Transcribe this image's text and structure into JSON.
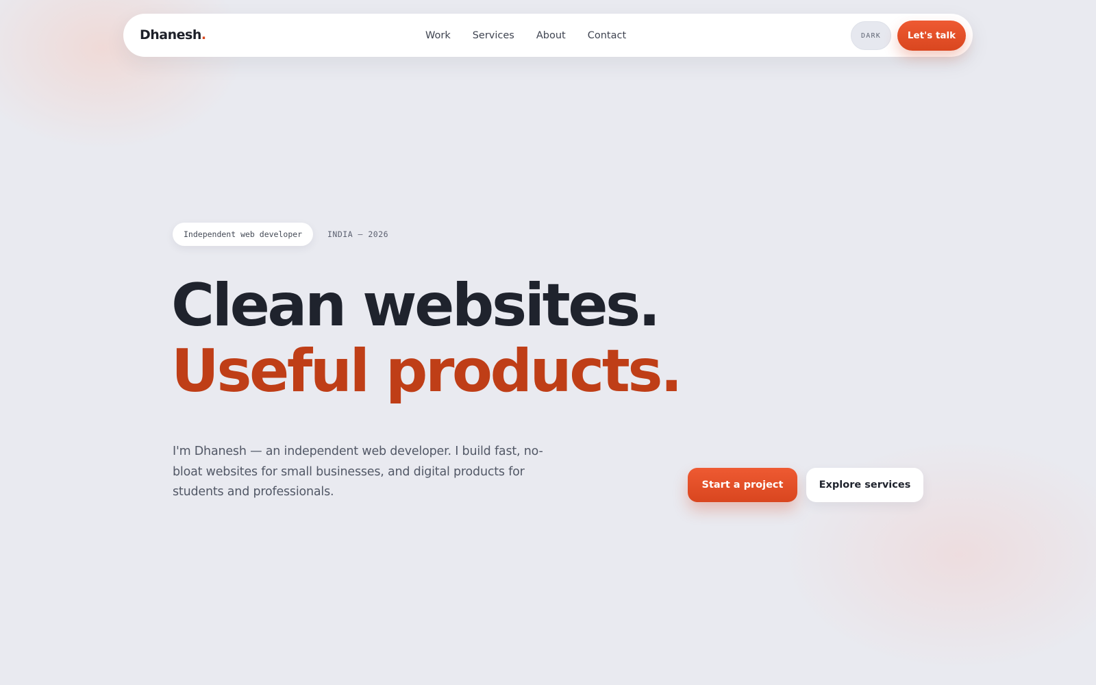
{
  "colors": {
    "accent": "#d9461f",
    "headline_accent": "#bf3e17",
    "background": "#e9eaf0",
    "text_dark": "#1f232d"
  },
  "nav": {
    "brand": "Dhanesh",
    "brand_dot": ".",
    "links": [
      "Work",
      "Services",
      "About",
      "Contact"
    ],
    "theme_toggle_label": "DARK",
    "cta_label": "Let's talk"
  },
  "hero": {
    "tag": "Independent web developer",
    "meta": "INDIA — 2026",
    "headline_line1": "Clean websites.",
    "headline_line2": "Useful products.",
    "intro": "I'm Dhanesh — an independent web developer. I build fast, no-bloat websites for small businesses, and digital products for students and professionals.",
    "primary_cta": "Start a project",
    "secondary_cta": "Explore services"
  }
}
